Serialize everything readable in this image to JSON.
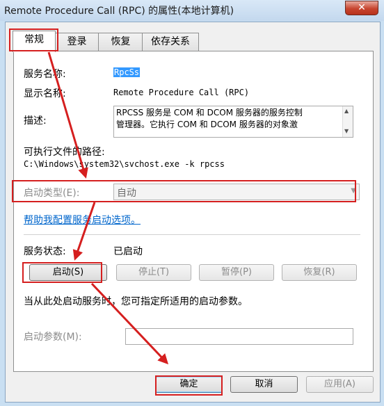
{
  "window": {
    "title": "Remote Procedure Call (RPC) 的属性(本地计算机)",
    "close_label": "✕"
  },
  "tabs": [
    "常规",
    "登录",
    "恢复",
    "依存关系"
  ],
  "general": {
    "service_name_label": "服务名称:",
    "service_name_value": "RpcSs",
    "display_name_label": "显示名称:",
    "display_name_value": "Remote Procedure Call (RPC)",
    "description_label": "描述:",
    "description_text": "RPCSS 服务是 COM 和 DCOM 服务器的服务控制\n管理器。它执行 COM 和 DCOM 服务器的对象激",
    "exe_path_label": "可执行文件的路径:",
    "exe_path_value": "C:\\Windows\\system32\\svchost.exe -k rpcss",
    "startup_type_label": "启动类型(E):",
    "startup_type_value": "自动",
    "help_link": "帮助我配置服务启动选项。",
    "status_label": "服务状态:",
    "status_value": "已启动",
    "buttons": {
      "start": "启动(S)",
      "stop": "停止(T)",
      "pause": "暂停(P)",
      "resume": "恢复(R)"
    },
    "hint": "当从此处启动服务时，您可指定所适用的启动参数。",
    "start_params_label": "启动参数(M):",
    "start_params_value": ""
  },
  "footer": {
    "ok": "确定",
    "cancel": "取消",
    "apply": "应用(A)"
  },
  "colors": {
    "highlight": "#d51f1f",
    "link": "#0066cc",
    "selection": "#3399ff"
  }
}
